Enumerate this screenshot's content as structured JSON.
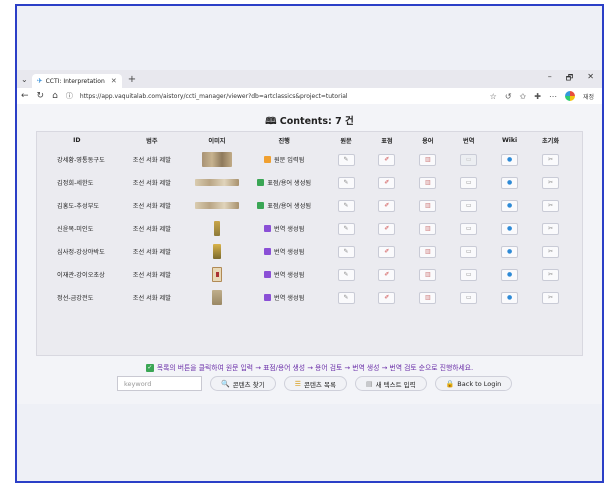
{
  "browser": {
    "tab_title": "CCTI: Interpretation Manager",
    "url": "https://app.vaquitalab.com/aistory/ccti_manager/viewer?db=artclassics&project=tutorial",
    "profile_label": "재정"
  },
  "page": {
    "heading": "Contents: 7 건"
  },
  "table": {
    "headers": [
      "ID",
      "범주",
      "이미지",
      "진행",
      "원문",
      "표점",
      "용어",
      "번역",
      "Wiki",
      "초기화"
    ],
    "rows": [
      {
        "id": "강세황-영통동구도",
        "category": "조선 서화 제발",
        "stage": "원문 입력됨",
        "stage_color": "#f0a030",
        "translate_enabled": false
      },
      {
        "id": "김정희-세한도",
        "category": "조선 서화 제발",
        "stage": "표점/용어 생성됨",
        "stage_color": "#3aa655",
        "translate_enabled": true
      },
      {
        "id": "김홍도-추성부도",
        "category": "조선 서화 제발",
        "stage": "표점/용어 생성됨",
        "stage_color": "#3aa655",
        "translate_enabled": true
      },
      {
        "id": "신윤복-미인도",
        "category": "조선 서화 제발",
        "stage": "번역 생성됨",
        "stage_color": "#8a4fd6",
        "translate_enabled": true
      },
      {
        "id": "심사정-강상야박도",
        "category": "조선 서화 제발",
        "stage": "번역 생성됨",
        "stage_color": "#8a4fd6",
        "translate_enabled": true
      },
      {
        "id": "이재관-강이오초상",
        "category": "조선 서화 제발",
        "stage": "번역 생성됨",
        "stage_color": "#8a4fd6",
        "translate_enabled": true
      },
      {
        "id": "정선-금강전도",
        "category": "조선 서화 제발",
        "stage": "번역 생성됨",
        "stage_color": "#8a4fd6",
        "translate_enabled": true
      }
    ]
  },
  "info": {
    "text": "목록의 버튼을 클릭하여 원문 입력 → 표점/용어 생성 → 용어 검토 → 번역 생성 → 번역 검토 순으로 진행하세요."
  },
  "controls": {
    "search_placeholder": "keyword",
    "find_label": "콘텐츠 찾기",
    "list_label": "콘텐츠 목록",
    "new_label": "새 텍스트 입력",
    "login_label": "Back to Login"
  },
  "icons": {
    "tab_favicon": "ccti-icon",
    "book": "book-icon",
    "search": "magnifier-icon",
    "list": "list-icon",
    "new": "document-icon",
    "login": "lock-icon"
  }
}
